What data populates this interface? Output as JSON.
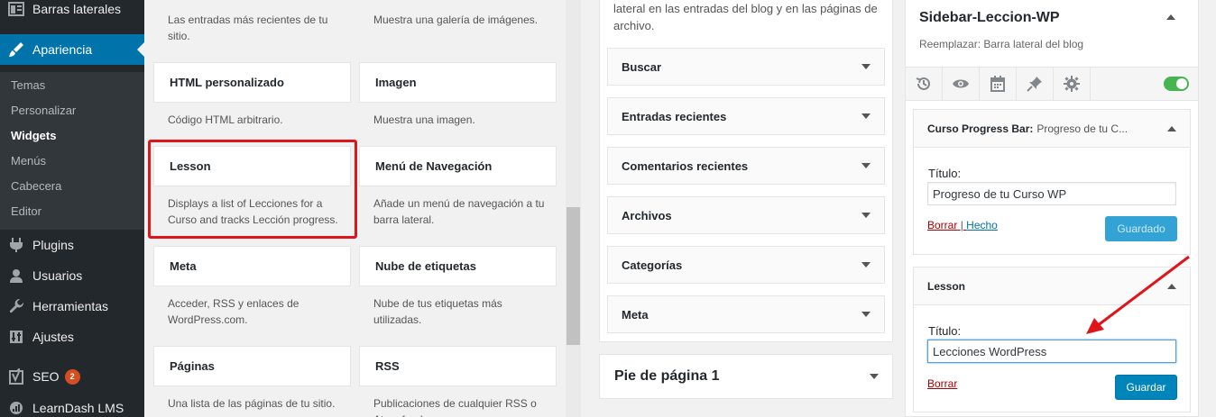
{
  "admin_menu": {
    "sidebars_item": "Barras laterales",
    "appearance_item": "Apariencia",
    "submenu": [
      "Temas",
      "Personalizar",
      "Widgets",
      "Menús",
      "Cabecera",
      "Editor"
    ],
    "plugins_item": "Plugins",
    "users_item": "Usuarios",
    "tools_item": "Herramientas",
    "settings_item": "Ajustes",
    "seo_item": "SEO",
    "seo_badge": "2",
    "learndash_item": "LearnDash LMS"
  },
  "available_widgets": {
    "top_desc_left": "Las entradas más recientes de tu sitio.",
    "top_desc_right": "Muestra una galería de imágenes.",
    "rows": [
      {
        "left": {
          "title": "HTML personalizado",
          "desc": "Código HTML arbitrario."
        },
        "right": {
          "title": "Imagen",
          "desc": "Muestra una imagen."
        }
      },
      {
        "left": {
          "title": "Lesson",
          "desc": "Displays a list of Lecciones for a Curso and tracks Lección progress."
        },
        "right": {
          "title": "Menú de Navegación",
          "desc": "Añade un menú de navegación a tu barra lateral."
        }
      },
      {
        "left": {
          "title": "Meta",
          "desc": "Acceder, RSS y enlaces de WordPress.com."
        },
        "right": {
          "title": "Nube de etiquetas",
          "desc": "Nube de tus etiquetas más utilizadas."
        }
      },
      {
        "left": {
          "title": "Páginas",
          "desc": "Una lista de las páginas de tu sitio."
        },
        "right": {
          "title": "RSS",
          "desc": "Publicaciones de cualquier RSS o Atom feed."
        }
      }
    ]
  },
  "blog_sidebar": {
    "description": "lateral en las entradas del blog y en las páginas de archivo.",
    "widgets": [
      "Buscar",
      "Entradas recientes",
      "Comentarios recientes",
      "Archivos",
      "Categorías",
      "Meta"
    ],
    "footer_title": "Pie de página 1"
  },
  "lesson_sidebar": {
    "title": "Sidebar-Leccion-WP",
    "subtitle": "Reemplazar: Barra lateral del blog",
    "toolbar_icons": [
      "history-icon",
      "visibility-icon",
      "calendar-icon",
      "pin-icon",
      "gear-icon",
      "toggle-switch"
    ],
    "widget1": {
      "head_title": "Curso Progress Bar:",
      "head_sub": "Progreso de tu C...",
      "field_label": "Título:",
      "field_value": "Progreso de tu Curso WP",
      "delete_link": "Borrar",
      "separator": "|",
      "done_link": "Hecho",
      "save_button": "Guardado"
    },
    "widget2": {
      "head_title": "Lesson",
      "field_label": "Título:",
      "field_value": "Lecciones WordPress",
      "delete_link": "Borrar",
      "save_button": "Guardar"
    }
  },
  "colors": {
    "admin_bg": "#23282d",
    "admin_active": "#0073aa",
    "highlight_box": "#e0151b",
    "annotation_arrow": "#e0151b",
    "toggle_on": "#46b450"
  }
}
